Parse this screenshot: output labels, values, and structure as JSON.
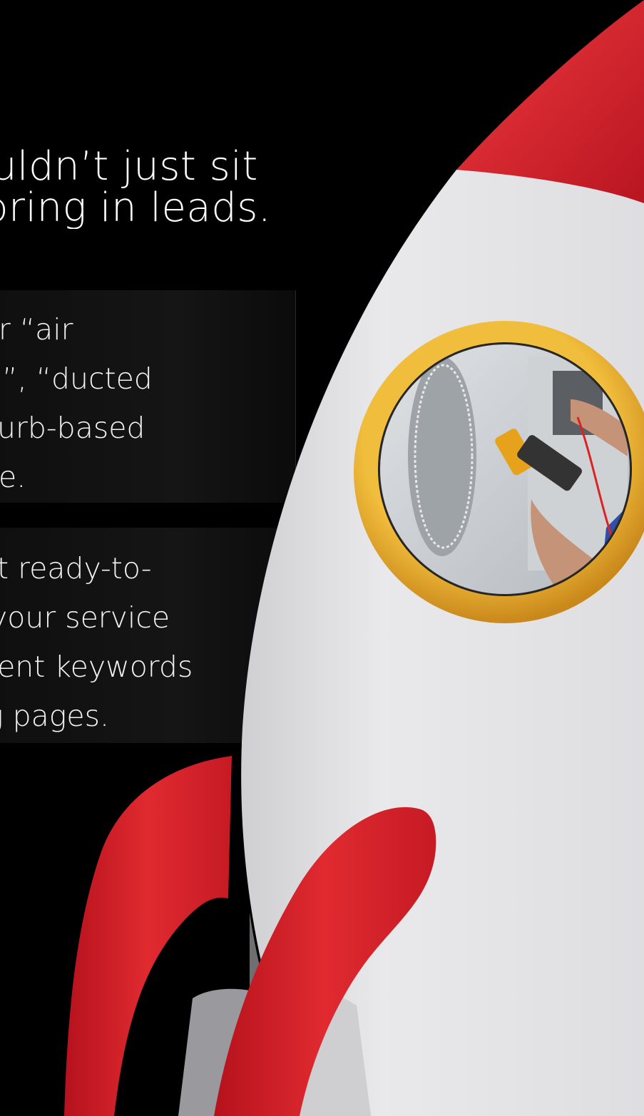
{
  "headline": {
    "line1": "uldn’t just sit",
    "line2": "bring in leads."
  },
  "card1": {
    "lines": [
      "r “air",
      "l”, “ducted",
      "burb-based",
      "e."
    ]
  },
  "card2": {
    "lines": [
      "t ready-to-",
      "your service",
      "tent keywords",
      "g pages."
    ]
  },
  "colors": {
    "background": "#000000",
    "rocket_red": "#d8202a",
    "rocket_body": "#e6e6e8",
    "porthole_ring": "#e0a52a"
  },
  "icons": {
    "rocket": "rocket-illustration",
    "porthole_photo": "technician-aircon-photo"
  }
}
